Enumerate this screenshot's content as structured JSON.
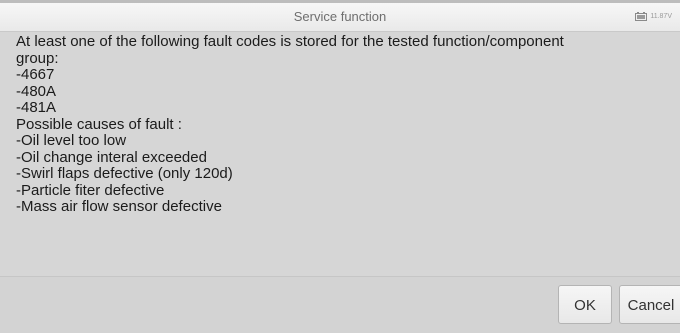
{
  "dialog": {
    "title": "Service function",
    "voltage": "11.87V",
    "battery_icon": "battery-icon"
  },
  "message": {
    "lines": [
      "At least one of the following fault codes is stored for the tested function/component",
      "group:",
      "-4667",
      "-480A",
      "-481A",
      "Possible causes of fault :",
      "-Oil level too low",
      "-Oil change interal exceeded",
      "-Swirl flaps defective (only 120d)",
      "-Particle fiter defective",
      "-Mass air flow sensor defective"
    ]
  },
  "buttons": {
    "ok_label": "OK",
    "cancel_label": "Cancel"
  }
}
